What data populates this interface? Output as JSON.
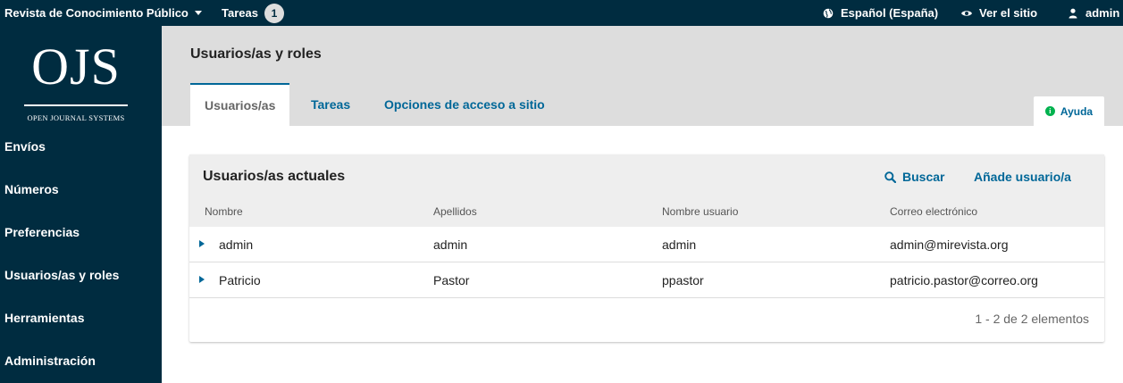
{
  "topbar": {
    "journal": "Revista de Conocimiento Público",
    "tasks_label": "Tareas",
    "tasks_count": "1",
    "language": "Español (España)",
    "view_site": "Ver el sitio",
    "user": "admin"
  },
  "logo": {
    "letters": "OJS",
    "subtitle": "OPEN JOURNAL SYSTEMS"
  },
  "sidebar": {
    "items": [
      {
        "label": "Envíos"
      },
      {
        "label": "Números"
      },
      {
        "label": "Preferencias"
      },
      {
        "label": "Usuarios/as y roles"
      },
      {
        "label": "Herramientas"
      },
      {
        "label": "Administración"
      }
    ]
  },
  "page": {
    "title": "Usuarios/as y roles",
    "tabs": [
      {
        "label": "Usuarios/as",
        "active": true
      },
      {
        "label": "Tareas",
        "active": false
      },
      {
        "label": "Opciones de acceso a sitio",
        "active": false
      }
    ],
    "help": "Ayuda"
  },
  "grid": {
    "title": "Usuarios/as actuales",
    "search": "Buscar",
    "add": "Añade usuario/a",
    "columns": [
      "Nombre",
      "Apellidos",
      "Nombre usuario",
      "Correo electrónico"
    ],
    "rows": [
      {
        "first": "admin",
        "last": "admin",
        "username": "admin",
        "email": "admin@mirevista.org"
      },
      {
        "first": "Patricio",
        "last": "Pastor",
        "username": "ppastor",
        "email": "patricio.pastor@correo.org"
      }
    ],
    "pager": "1 - 2 de 2 elementos"
  },
  "colors": {
    "navy": "#002c40",
    "link": "#006798",
    "header_bg": "#dddddd",
    "help_green": "#00b24e"
  },
  "icons": [
    "chevron-down-icon",
    "globe-icon",
    "eye-icon",
    "user-icon",
    "info-icon",
    "search-icon",
    "triangle-right-icon"
  ]
}
